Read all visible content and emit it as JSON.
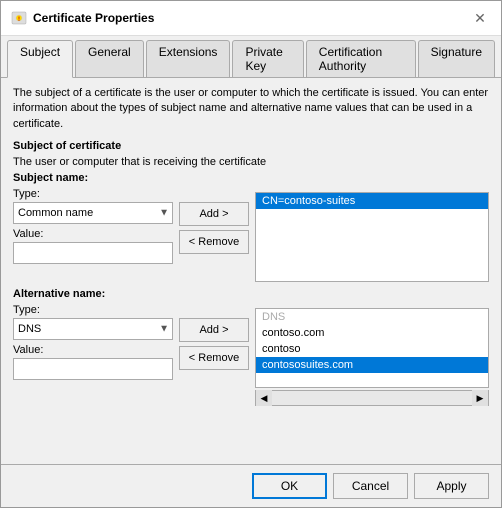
{
  "dialog": {
    "title": "Certificate Properties",
    "close_label": "✕"
  },
  "tabs": [
    {
      "label": "Subject",
      "active": true
    },
    {
      "label": "General",
      "active": false
    },
    {
      "label": "Extensions",
      "active": false
    },
    {
      "label": "Private Key",
      "active": false
    },
    {
      "label": "Certification Authority",
      "active": false
    },
    {
      "label": "Signature",
      "active": false
    }
  ],
  "info_text": "The subject of a certificate is the user or computer to which the certificate is issued. You can enter information about the types of subject name and alternative name values that can be used in a certificate.",
  "subject_of_certificate": "Subject of certificate",
  "subject_subtitle": "The user or computer that is receiving the certificate",
  "subject_name_group": {
    "label": "Subject name:",
    "type_label": "Type:",
    "type_value": "Common name",
    "value_label": "Value:"
  },
  "alternative_name_group": {
    "label": "Alternative name:",
    "type_label": "Type:",
    "type_value": "DNS",
    "value_label": "Value:"
  },
  "buttons": {
    "add": "Add >",
    "remove": "< Remove",
    "ok": "OK",
    "cancel": "Cancel",
    "apply": "Apply"
  },
  "subject_list": {
    "items": [
      {
        "label": "CN=contoso-suites",
        "selected": true
      }
    ]
  },
  "alternative_list": {
    "header": "DNS",
    "items": [
      {
        "label": "contoso.com",
        "selected": false
      },
      {
        "label": "contoso",
        "selected": false
      },
      {
        "label": "contososuites.com",
        "selected": true
      }
    ]
  },
  "colors": {
    "accent": "#0078d7",
    "selected_bg": "#0078d7"
  }
}
